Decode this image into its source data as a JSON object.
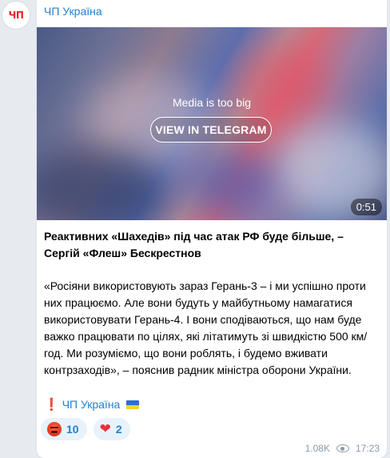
{
  "channel": {
    "name": "ЧП Україна",
    "avatar_text": "ЧП"
  },
  "media": {
    "notice": "Media is too big",
    "button_label": "VIEW IN TELEGRAM",
    "duration": "0:51"
  },
  "post": {
    "headline": "Реактивних «Шахедів» під час атак РФ буде більше, – Сергій «Флеш» Бескрестнов",
    "body": "«Росіяни використовують зараз Герань-3 – і ми успішно проти них працюємо. Але вони будуть у майбутньому намагатися використовувати Герань-4. І вони сподіваються, що нам буде важко працювати по цілях, які літатимуть зі швидкістю 500 км/год. Ми розуміємо, що вони роблять, і будемо вживати контрзаходів», – пояснив радник міністра оборони України.",
    "signature_mark": "❗",
    "signature": "ЧП Україна"
  },
  "reactions": [
    {
      "icon": "angry-face-icon",
      "count": "10"
    },
    {
      "icon": "heart-icon",
      "count": "2"
    }
  ],
  "meta": {
    "views": "1.08K",
    "time": "17:23"
  },
  "colors": {
    "link": "#2481cc",
    "background": "#e7ebf0",
    "reaction_bg": "#e8f2fb"
  }
}
